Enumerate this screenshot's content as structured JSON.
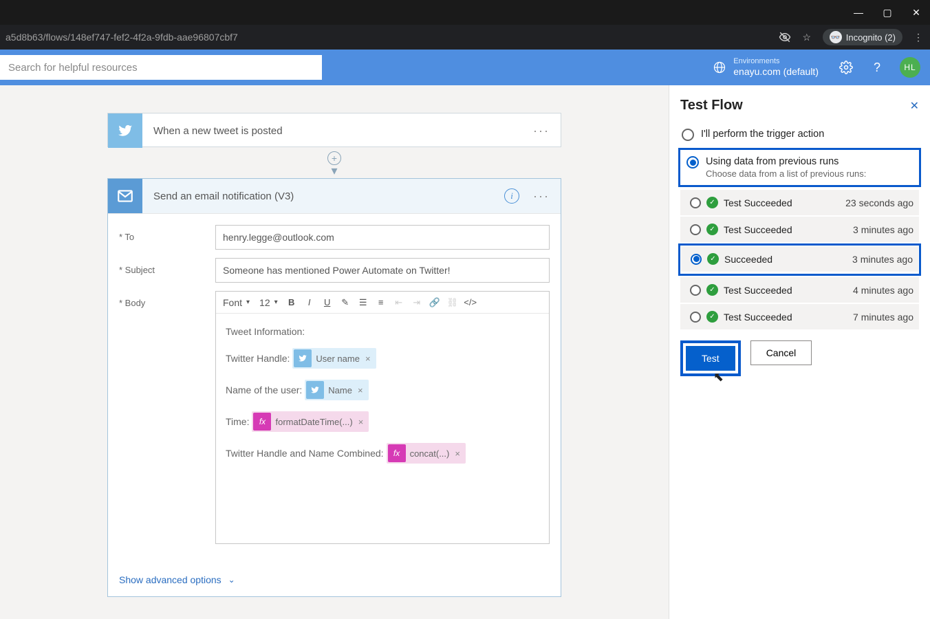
{
  "browser": {
    "url": "a5d8b63/flows/148ef747-fef2-4f2a-9fdb-aae96807cbf7",
    "incognito_label": "Incognito (2)"
  },
  "header": {
    "search_placeholder": "Search for helpful resources",
    "env_label": "Environments",
    "env_value": "enayu.com (default)",
    "avatar_initials": "HL"
  },
  "trigger": {
    "title": "When a new tweet is posted"
  },
  "action": {
    "title": "Send an email notification (V3)",
    "to_label": "* To",
    "to_value": "henry.legge@outlook.com",
    "subject_label": "* Subject",
    "subject_value": "Someone has mentioned Power Automate on Twitter!",
    "body_label": "* Body",
    "font_label": "Font",
    "font_size": "12",
    "body_lines": {
      "l0": "Tweet Information:",
      "l1_prefix": "Twitter Handle:",
      "l1_token": "User name",
      "l2_prefix": "Name of the user:",
      "l2_token": "Name",
      "l3_prefix": "Time:",
      "l3_token": "formatDateTime(...)",
      "l4_prefix": "Twitter Handle and Name Combined:",
      "l4_token": "concat(...)"
    },
    "advanced": "Show advanced options"
  },
  "panel": {
    "title": "Test Flow",
    "opt1": "I'll perform the trigger action",
    "opt2": "Using data from previous runs",
    "opt2_sub": "Choose data from a list of previous runs:",
    "runs": [
      {
        "name": "Test Succeeded",
        "time": "23 seconds ago",
        "selected": false
      },
      {
        "name": "Test Succeeded",
        "time": "3 minutes ago",
        "selected": false
      },
      {
        "name": "Succeeded",
        "time": "3 minutes ago",
        "selected": true
      },
      {
        "name": "Test Succeeded",
        "time": "4 minutes ago",
        "selected": false
      },
      {
        "name": "Test Succeeded",
        "time": "7 minutes ago",
        "selected": false
      }
    ],
    "test_btn": "Test",
    "cancel_btn": "Cancel"
  }
}
